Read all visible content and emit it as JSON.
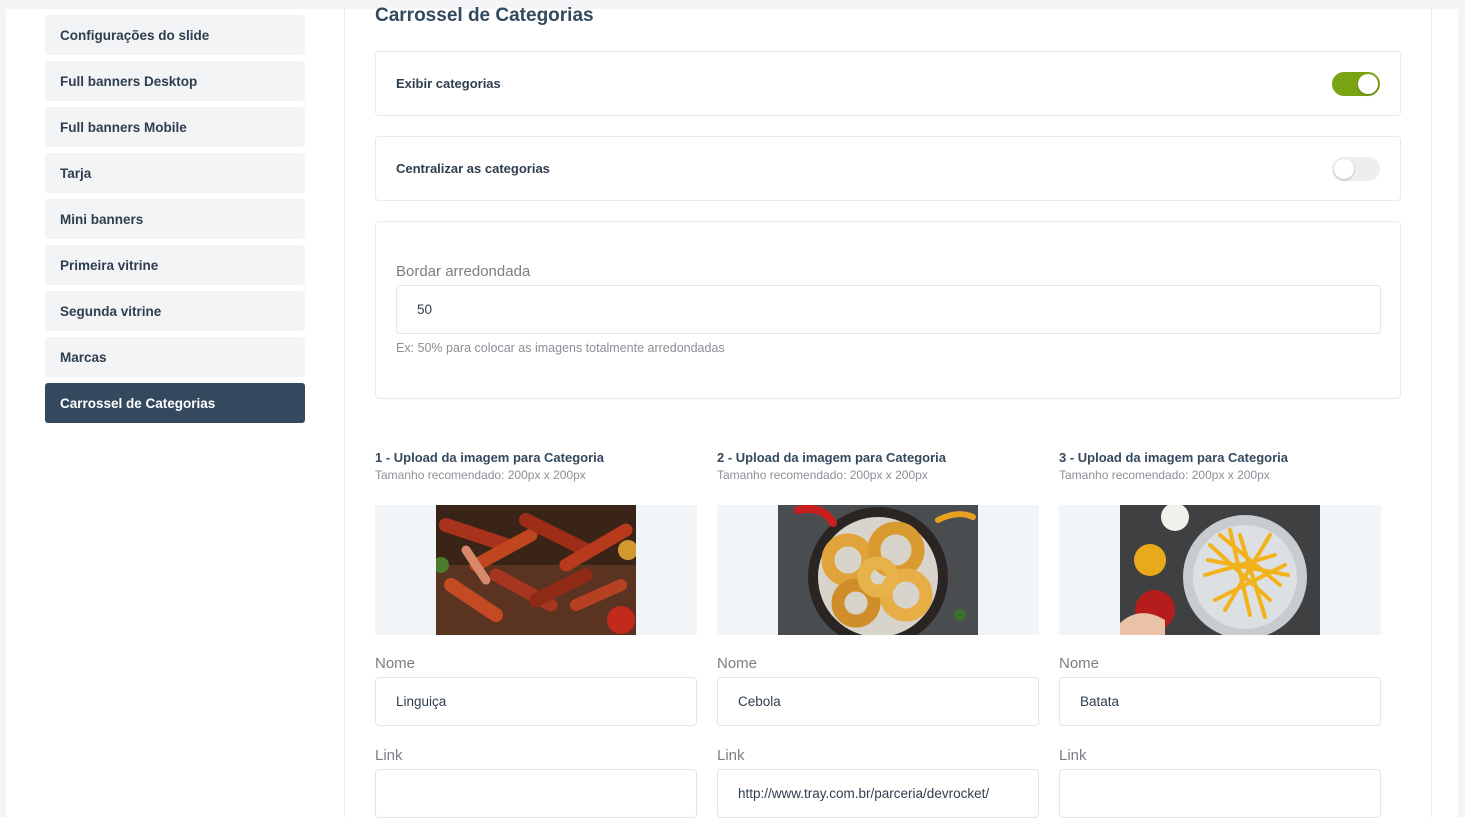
{
  "sidebar": {
    "items": [
      {
        "label": "Configurações do slide"
      },
      {
        "label": "Full banners Desktop"
      },
      {
        "label": "Full banners Mobile"
      },
      {
        "label": "Tarja"
      },
      {
        "label": "Mini banners"
      },
      {
        "label": "Primeira vitrine"
      },
      {
        "label": "Segunda vitrine"
      },
      {
        "label": "Marcas"
      },
      {
        "label": "Carrossel de Categorias",
        "active": true
      }
    ]
  },
  "main": {
    "title": "Carrossel de Categorias",
    "toggles": [
      {
        "label": "Exibir categorias",
        "on": true
      },
      {
        "label": "Centralizar as categorias",
        "on": false
      }
    ],
    "border_radius": {
      "label": "Bordar arredondada",
      "value": "50",
      "help": "Ex: 50% para colocar as imagens totalmente arredondadas"
    },
    "categories": [
      {
        "upload_title": "1 - Upload da imagem para Categoria",
        "size_hint": "Tamanho recomendado: 200px x 200px",
        "image": "sausages-photo",
        "name_label": "Nome",
        "name_value": "Linguiça",
        "link_label": "Link",
        "link_value": ""
      },
      {
        "upload_title": "2 - Upload da imagem para Categoria",
        "size_hint": "Tamanho recomendado: 200px x 200px",
        "image": "onion-rings-photo",
        "name_label": "Nome",
        "name_value": "Cebola",
        "link_label": "Link",
        "link_value": "http://www.tray.com.br/parceria/devrocket/"
      },
      {
        "upload_title": "3 - Upload da imagem para Categoria",
        "size_hint": "Tamanho recomendado: 200px x 200px",
        "image": "french-fries-photo",
        "name_label": "Nome",
        "name_value": "Batata",
        "link_label": "Link",
        "link_value": ""
      }
    ]
  },
  "colors": {
    "active_sidebar": "#34495e",
    "toggle_on": "#7aa314",
    "toggle_off": "#eeeeee"
  }
}
